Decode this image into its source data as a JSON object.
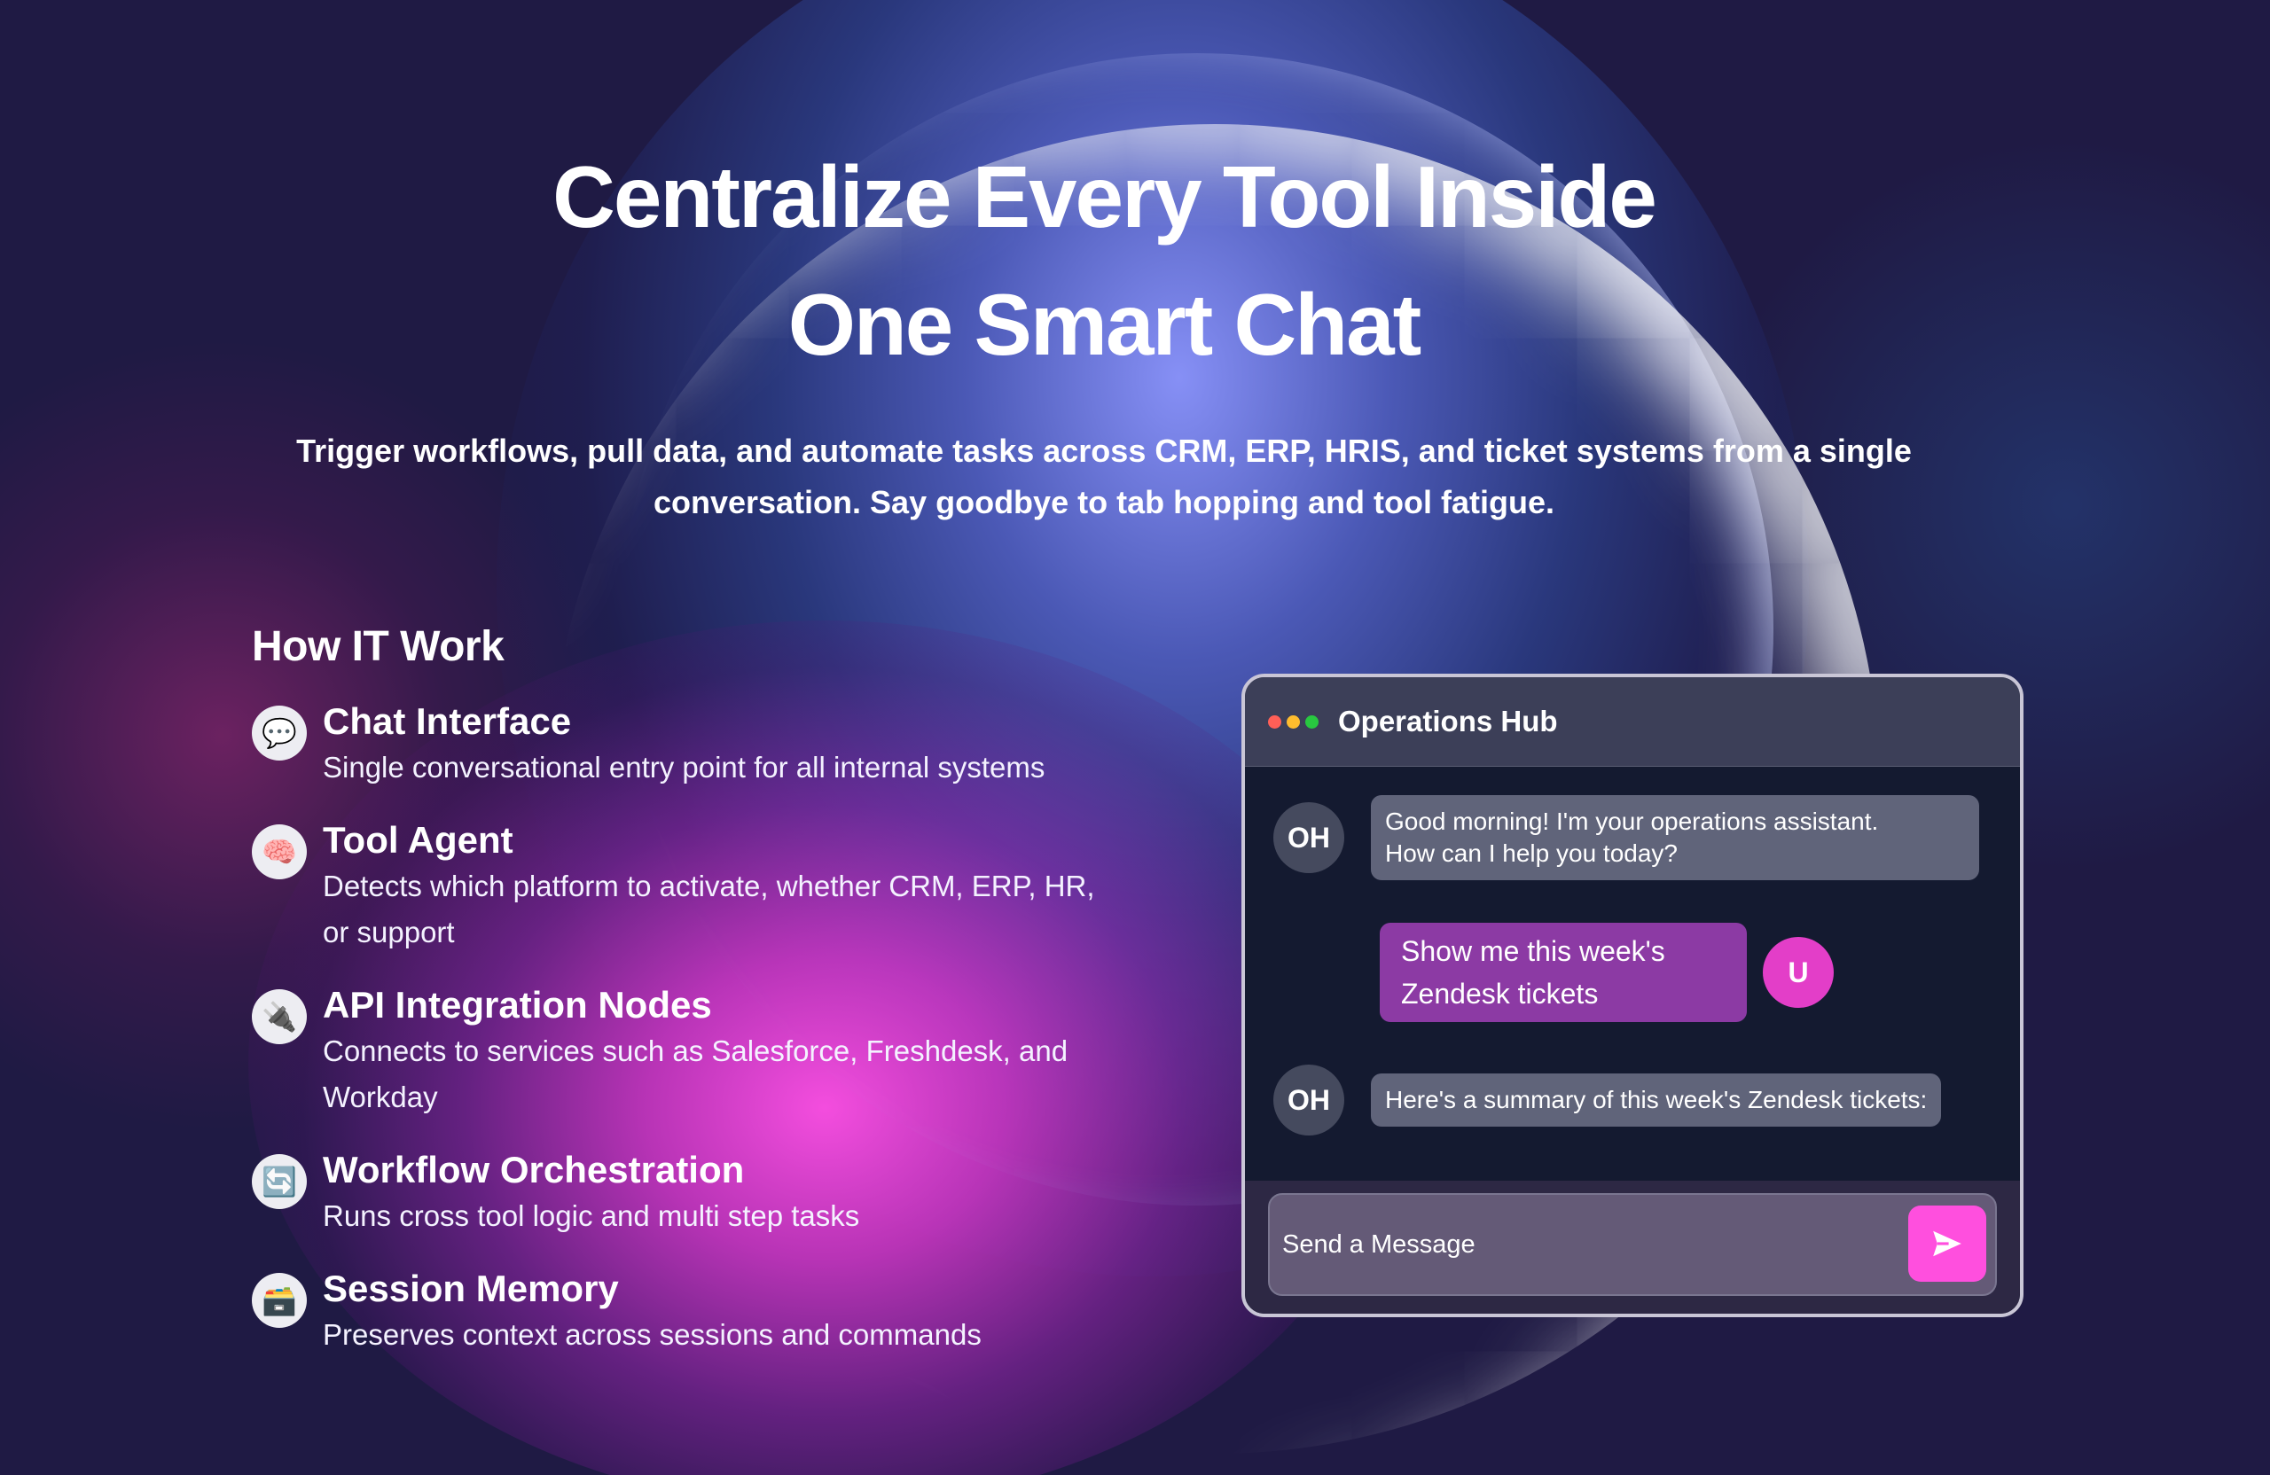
{
  "hero": {
    "title_line1": "Centralize Every Tool Inside",
    "title_line2": "One Smart Chat",
    "subtitle_line1": "Trigger workflows, pull data, and automate tasks across CRM, ERP, HRIS, and ticket systems from a single",
    "subtitle_line2": "conversation. Say goodbye to tab hopping and tool fatigue."
  },
  "how": {
    "title": "How IT Work",
    "features": [
      {
        "icon": "speech-balloon-icon",
        "glyph": "💬",
        "title": "Chat Interface",
        "desc": "Single conversational entry point for all internal systems"
      },
      {
        "icon": "brain-icon",
        "glyph": "🧠",
        "title": "Tool Agent",
        "desc": "Detects which platform to activate, whether CRM, ERP, HR, or support"
      },
      {
        "icon": "plug-icon",
        "glyph": "🔌",
        "title": "API Integration Nodes",
        "desc": "Connects to services such as Salesforce, Freshdesk, and Workday"
      },
      {
        "icon": "refresh-icon",
        "glyph": "🔄",
        "title": "Workflow Orchestration",
        "desc": "Runs cross tool logic and multi step tasks"
      },
      {
        "icon": "card-file-box-icon",
        "glyph": "🗃️",
        "title": "Session Memory",
        "desc": "Preserves context across sessions and commands"
      }
    ]
  },
  "chat": {
    "title": "Operations Hub",
    "window_dots": [
      "#ff5f57",
      "#febc2e",
      "#28c840"
    ],
    "messages": [
      {
        "sender": "bot",
        "avatar": "OH",
        "line1": "Good morning! I'm your operations assistant.",
        "line2": "How can I help you today?"
      },
      {
        "sender": "user",
        "avatar": "U",
        "text": "Show me this week's Zendesk tickets"
      },
      {
        "sender": "bot",
        "avatar": "OH",
        "text": "Here's a summary of this week's Zendesk tickets:"
      }
    ],
    "input_placeholder": "Send a Message",
    "send_icon": "send-icon",
    "accent": "#ff4fde"
  }
}
